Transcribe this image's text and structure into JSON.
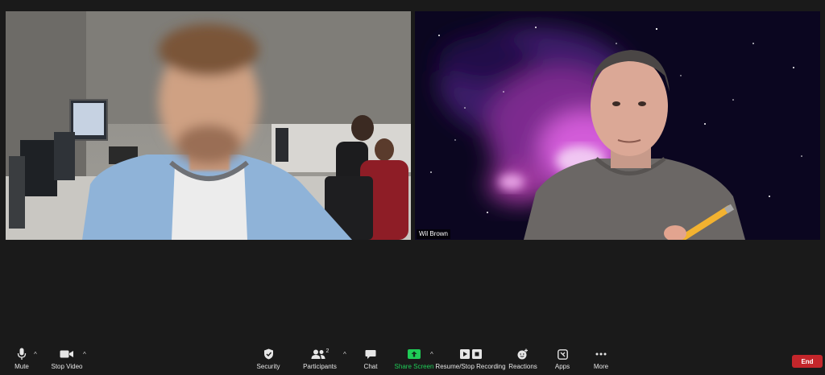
{
  "participants": [
    {
      "name": ""
    },
    {
      "name": "Wil Brown"
    }
  ],
  "toolbar": {
    "mute_label": "Mute",
    "stop_video_label": "Stop Video",
    "security_label": "Security",
    "participants_label": "Participants",
    "participants_count": "2",
    "chat_label": "Chat",
    "share_screen_label": "Share Screen",
    "recording_label": "Resume/Stop Recording",
    "reactions_label": "Reactions",
    "apps_label": "Apps",
    "more_label": "More",
    "end_label": "End"
  },
  "colors": {
    "background": "#1a1a1a",
    "share_screen": "#1fcc57",
    "end_button": "#c4262b"
  }
}
